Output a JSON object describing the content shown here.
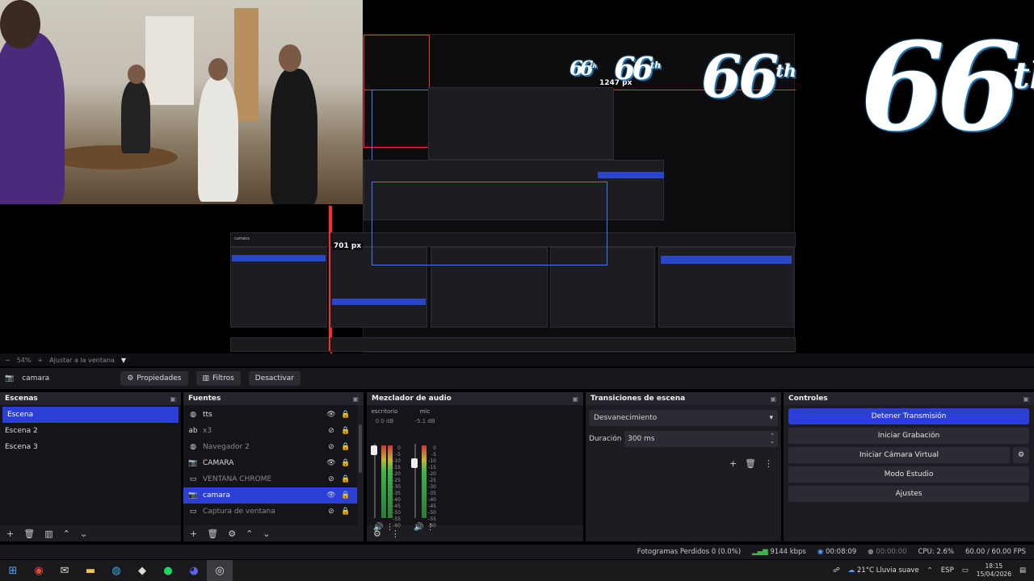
{
  "preview": {
    "nested_labels": {
      "px_1247": "1247 px",
      "px_701": "701 px"
    },
    "logo": {
      "number": "66",
      "suffix": "th"
    }
  },
  "zoombar": {
    "minus": "−",
    "zoom": "54%",
    "plus": "+",
    "fit": "Ajustar a la ventana",
    "caret": "▼"
  },
  "context": {
    "source_name": "camara",
    "properties_label": "Propiedades",
    "filters_label": "Filtros",
    "deactivate_label": "Desactivar"
  },
  "scenes": {
    "title": "Escenas",
    "items": [
      "Escena",
      "Escena 2",
      "Escena 3"
    ]
  },
  "sources": {
    "title": "Fuentes",
    "items": [
      {
        "name": "tts",
        "icon": "globe"
      },
      {
        "name": "x3",
        "icon": "text"
      },
      {
        "name": "Navegador 2",
        "icon": "globe"
      },
      {
        "name": "CAMARA",
        "icon": "camera"
      },
      {
        "name": "VENTANA CHROME",
        "icon": "window"
      },
      {
        "name": "camara",
        "icon": "camera"
      },
      {
        "name": "Captura de ventana",
        "icon": "window"
      }
    ]
  },
  "mixer": {
    "title": "Mezclador de audio",
    "channels": [
      {
        "name": "escritorio",
        "db": "0.0 dB"
      },
      {
        "name": "mic",
        "db": "-5.1 dB"
      }
    ],
    "scale": [
      "0",
      "-5",
      "-10",
      "-15",
      "-20",
      "-25",
      "-30",
      "-35",
      "-40",
      "-45",
      "-50",
      "-55",
      "-60"
    ]
  },
  "transitions": {
    "title": "Transiciones de escena",
    "selected": "Desvanecimiento",
    "duration_label": "Duración",
    "duration_value": "300 ms"
  },
  "controls": {
    "title": "Controles",
    "buttons": [
      "Detener Transmisión",
      "Iniciar Grabación",
      "Iniciar Cámara Virtual",
      "Modo Estudio",
      "Ajustes"
    ]
  },
  "status": {
    "dropped": "Fotogramas Perdidos 0 (0.0%)",
    "bitrate": "9144 kbps",
    "stream_time": "00:08:09",
    "rec_time": "00:00:00",
    "cpu": "CPU: 2.6%",
    "fps": "60.00 / 60.00 FPS"
  },
  "taskbar": {
    "weather": "21°C  Lluvia suave",
    "lang": "ESP",
    "time": "18:15",
    "date": "15/04/2026"
  },
  "colors": {
    "accent": "#2b3ed6",
    "meter_green": "#3fb54a",
    "bg": "#1c1c22"
  }
}
